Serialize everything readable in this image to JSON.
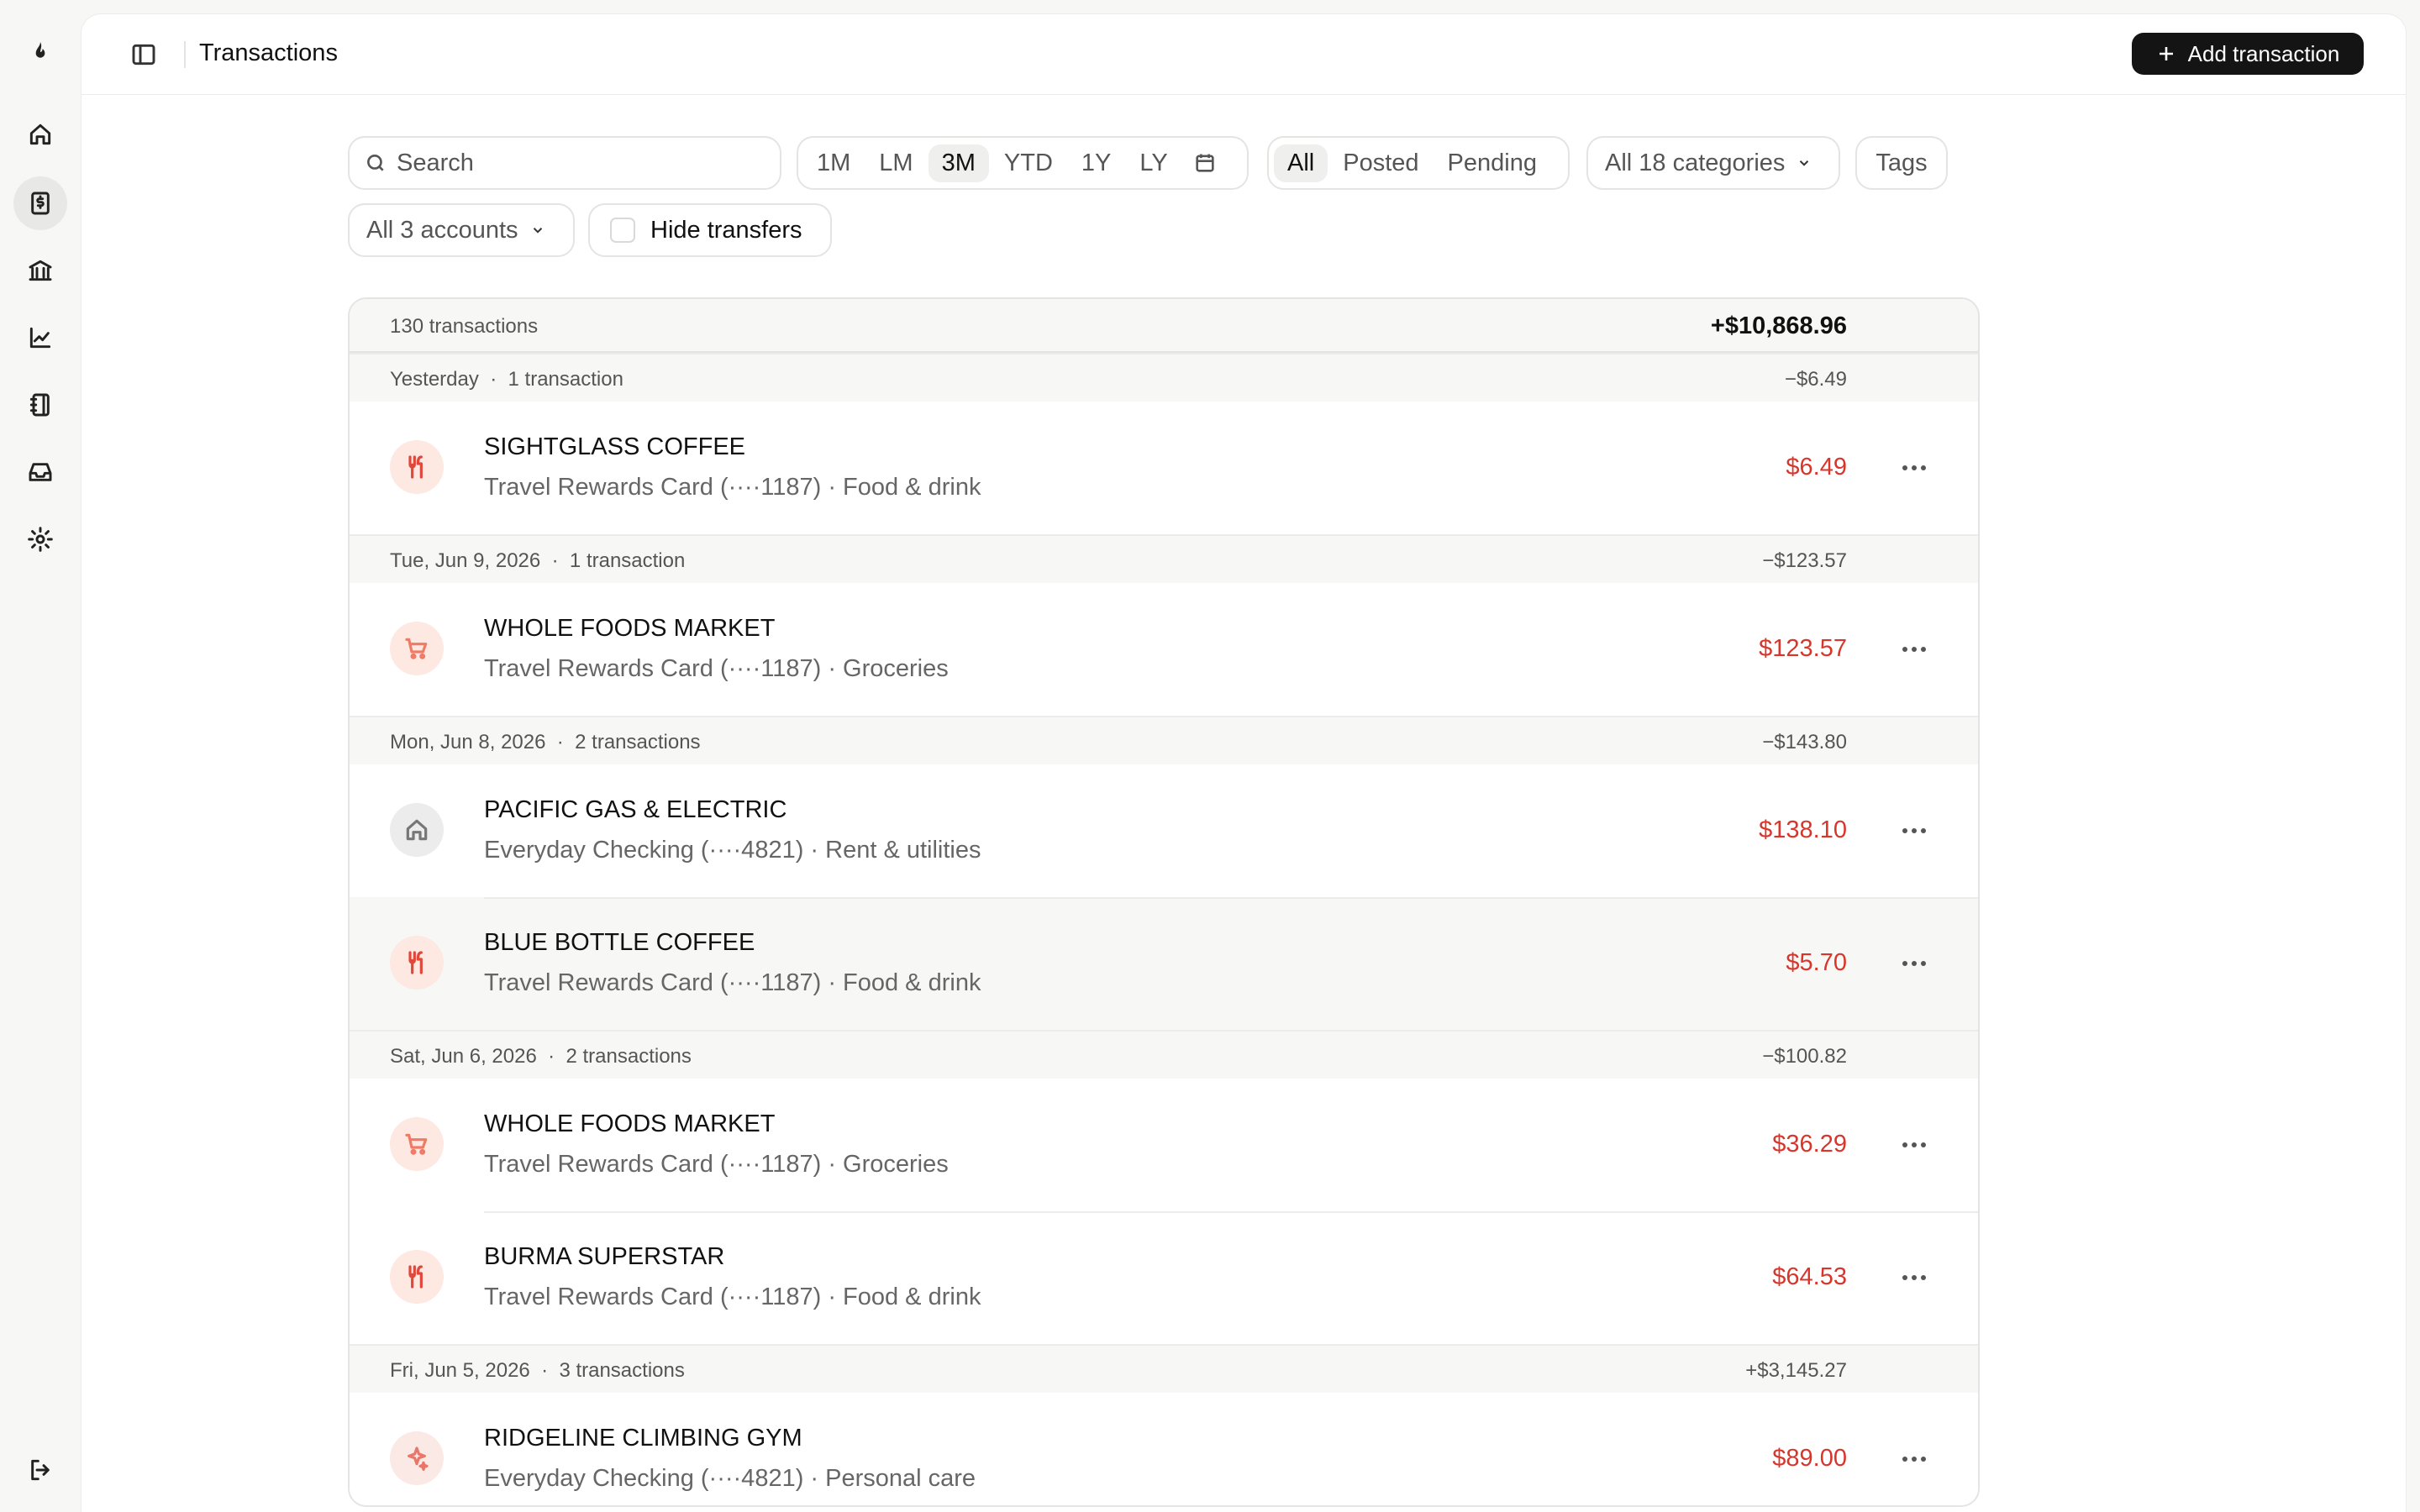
{
  "header": {
    "title": "Transactions",
    "add_label": "Add transaction"
  },
  "filters": {
    "search_placeholder": "Search",
    "periods": [
      "1M",
      "LM",
      "3M",
      "YTD",
      "1Y",
      "LY"
    ],
    "active_period": "3M",
    "statuses": [
      "All",
      "Posted",
      "Pending"
    ],
    "active_status": "All",
    "categories_label": "All 18 categories",
    "tags_label": "Tags",
    "accounts_label": "All 3 accounts",
    "hide_transfers_label": "Hide transfers"
  },
  "summary": {
    "count": "130 transactions",
    "total": "+$10,868.96"
  },
  "groups": [
    {
      "date": "Yesterday",
      "count": "1 transaction",
      "total": "−$6.49",
      "rows": [
        {
          "merchant": "SIGHTGLASS COFFEE",
          "meta": "Travel Rewards Card (····1187) · Food & drink",
          "amount": "$6.49",
          "icon": "utensils-icon"
        }
      ]
    },
    {
      "date": "Tue, Jun 9, 2026",
      "count": "1 transaction",
      "total": "−$123.57",
      "rows": [
        {
          "merchant": "WHOLE FOODS MARKET",
          "meta": "Travel Rewards Card (····1187) · Groceries",
          "amount": "$123.57",
          "icon": "shopping-cart-icon"
        }
      ]
    },
    {
      "date": "Mon, Jun 8, 2026",
      "count": "2 transactions",
      "total": "−$143.80",
      "rows": [
        {
          "merchant": "PACIFIC GAS & ELECTRIC",
          "meta": "Everyday Checking (····4821) · Rent & utilities",
          "amount": "$138.10",
          "icon": "home-icon"
        },
        {
          "merchant": "BLUE BOTTLE COFFEE",
          "meta": "Travel Rewards Card (····1187) · Food & drink",
          "amount": "$5.70",
          "icon": "utensils-icon"
        }
      ]
    },
    {
      "date": "Sat, Jun 6, 2026",
      "count": "2 transactions",
      "total": "−$100.82",
      "rows": [
        {
          "merchant": "WHOLE FOODS MARKET",
          "meta": "Travel Rewards Card (····1187) · Groceries",
          "amount": "$36.29",
          "icon": "shopping-cart-icon"
        },
        {
          "merchant": "BURMA SUPERSTAR",
          "meta": "Travel Rewards Card (····1187) · Food & drink",
          "amount": "$64.53",
          "icon": "utensils-icon"
        }
      ]
    },
    {
      "date": "Fri, Jun 5, 2026",
      "count": "3 transactions",
      "total": "+$3,145.27",
      "rows": [
        {
          "merchant": "RIDGELINE CLIMBING GYM",
          "meta": "Everyday Checking (····4821) · Personal care",
          "amount": "$89.00",
          "icon": "sparkle-icon"
        }
      ]
    }
  ],
  "colors": {
    "negative_amount": "#d9352b",
    "primary_button": "#141414"
  }
}
